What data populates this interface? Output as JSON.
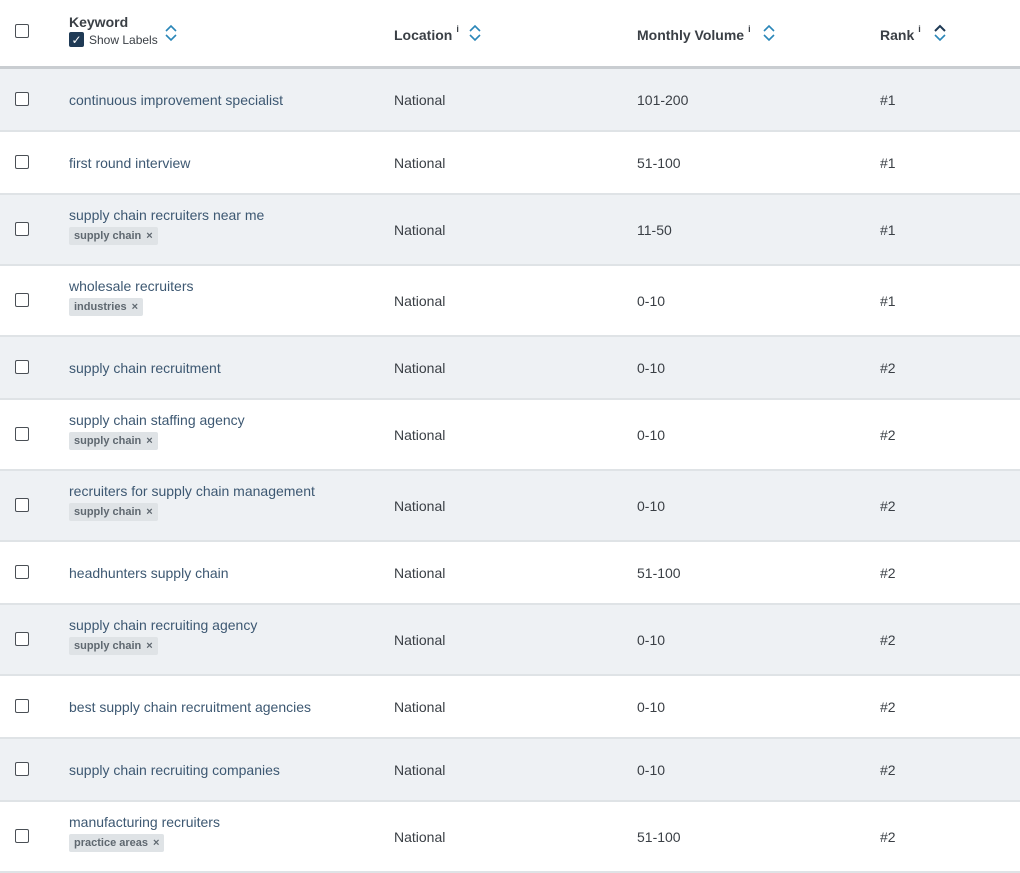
{
  "header": {
    "keyword": "Keyword",
    "show_labels": "Show Labels",
    "location": "Location",
    "monthly_volume": "Monthly Volume",
    "rank": "Rank",
    "info_glyph": "i"
  },
  "rows": [
    {
      "keyword": "continuous improvement specialist",
      "tag": "",
      "location": "National",
      "volume": "101-200",
      "rank": "#1"
    },
    {
      "keyword": "first round interview",
      "tag": "",
      "location": "National",
      "volume": "51-100",
      "rank": "#1"
    },
    {
      "keyword": "supply chain recruiters near me",
      "tag": "supply chain",
      "location": "National",
      "volume": "11-50",
      "rank": "#1"
    },
    {
      "keyword": "wholesale recruiters",
      "tag": "industries",
      "location": "National",
      "volume": "0-10",
      "rank": "#1"
    },
    {
      "keyword": "supply chain recruitment",
      "tag": "",
      "location": "National",
      "volume": "0-10",
      "rank": "#2"
    },
    {
      "keyword": "supply chain staffing agency",
      "tag": "supply chain",
      "location": "National",
      "volume": "0-10",
      "rank": "#2"
    },
    {
      "keyword": "recruiters for supply chain management",
      "tag": "supply chain",
      "location": "National",
      "volume": "0-10",
      "rank": "#2"
    },
    {
      "keyword": "headhunters supply chain",
      "tag": "",
      "location": "National",
      "volume": "51-100",
      "rank": "#2"
    },
    {
      "keyword": "supply chain recruiting agency",
      "tag": "supply chain",
      "location": "National",
      "volume": "0-10",
      "rank": "#2"
    },
    {
      "keyword": "best supply chain recruitment agencies",
      "tag": "",
      "location": "National",
      "volume": "0-10",
      "rank": "#2"
    },
    {
      "keyword": "supply chain recruiting companies",
      "tag": "",
      "location": "National",
      "volume": "0-10",
      "rank": "#2"
    },
    {
      "keyword": "manufacturing recruiters",
      "tag": "practice areas",
      "location": "National",
      "volume": "51-100",
      "rank": "#2"
    }
  ],
  "colors": {
    "accent": "#2a86b8",
    "row_alt": "#eef1f4",
    "tag_bg": "#dfe3e6",
    "link": "#3d5872"
  }
}
